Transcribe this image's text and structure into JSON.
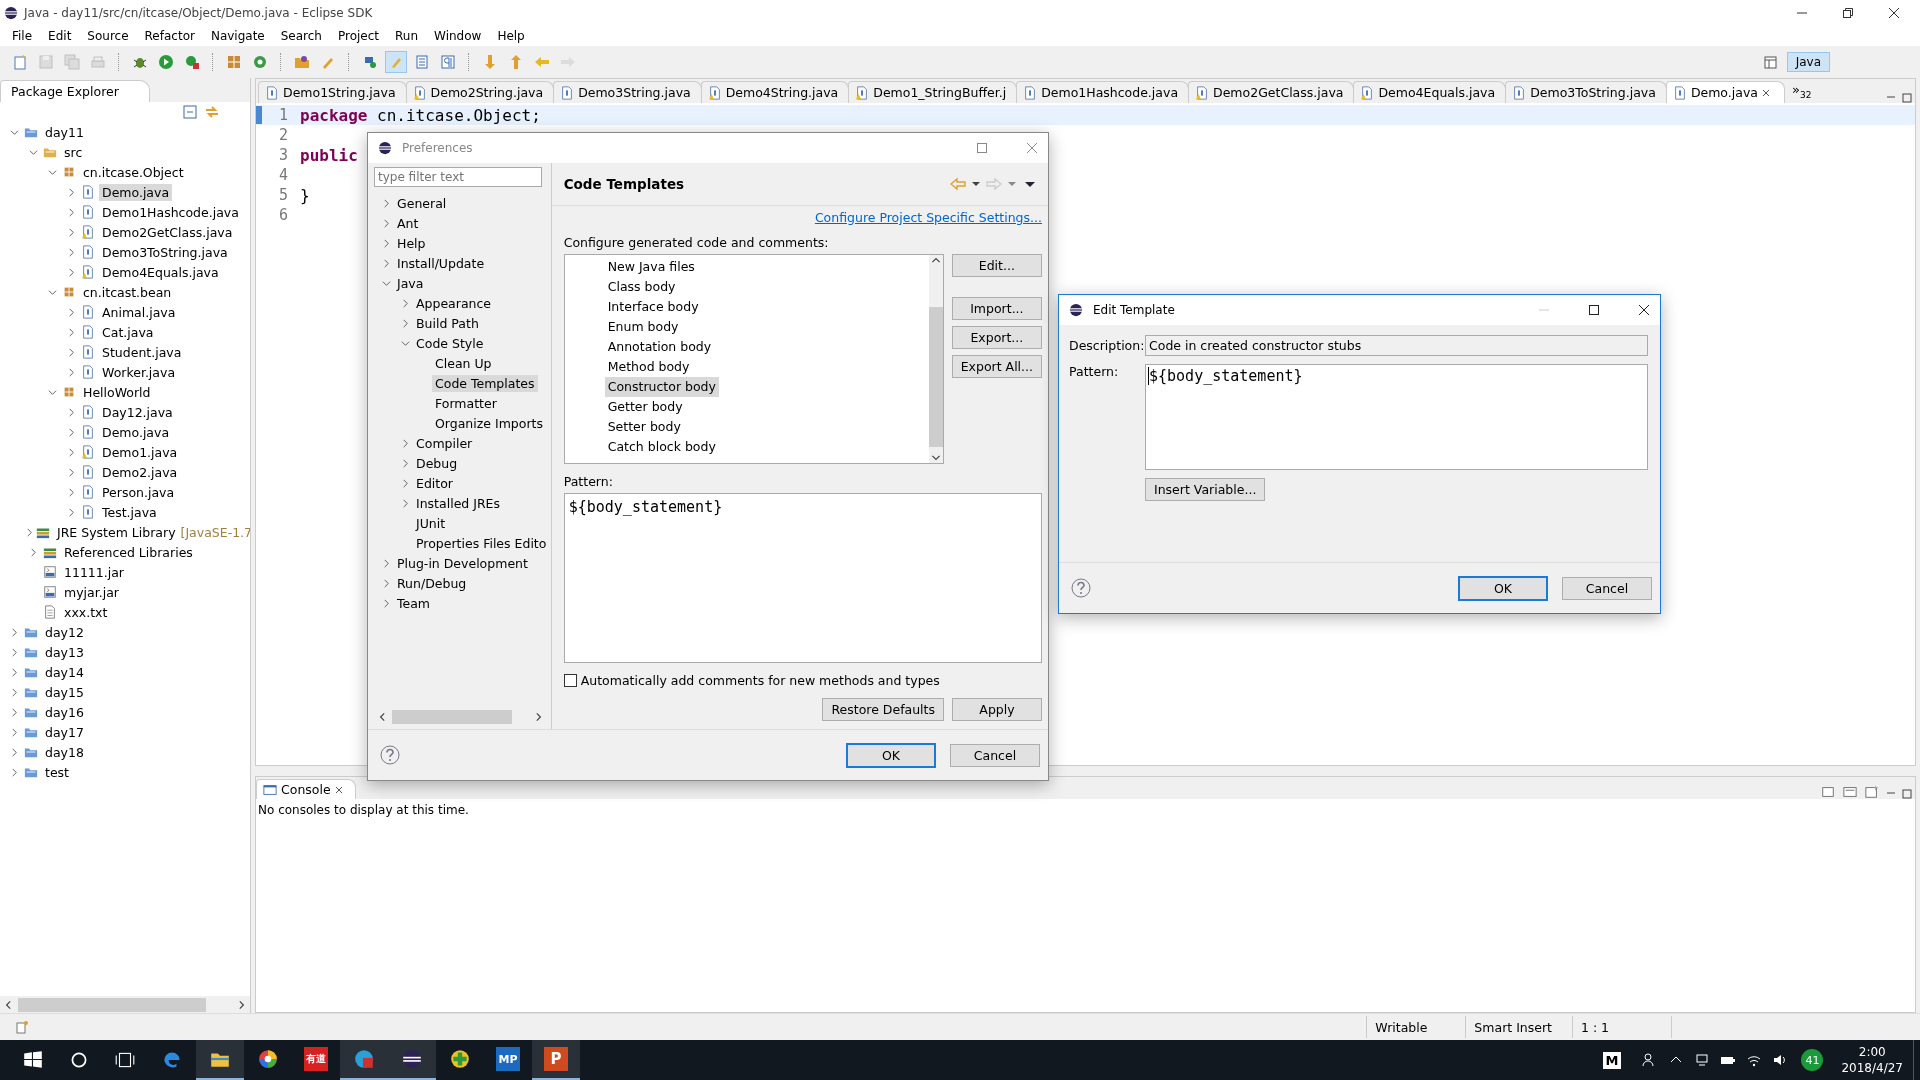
{
  "window": {
    "title": "Java - day11/src/cn/itcase/Object/Demo.java - Eclipse SDK"
  },
  "menu": [
    "File",
    "Edit",
    "Source",
    "Refactor",
    "Navigate",
    "Search",
    "Project",
    "Run",
    "Window",
    "Help"
  ],
  "perspective": {
    "label": "Java",
    "selected": true
  },
  "package_explorer": {
    "title": "Package Explorer",
    "items": [
      {
        "label": "day11",
        "kind": "project",
        "expanded": true,
        "selected": false,
        "children": [
          {
            "label": "src",
            "kind": "srcfolder",
            "expanded": true,
            "selected": false,
            "children": [
              {
                "label": "cn.itcase.Object",
                "kind": "package",
                "expanded": true,
                "selected": false,
                "children": [
                  {
                    "label": "Demo.java",
                    "kind": "java",
                    "expanded": false,
                    "selected": true
                  },
                  {
                    "label": "Demo1Hashcode.java",
                    "kind": "java",
                    "expanded": false,
                    "selected": false
                  },
                  {
                    "label": "Demo2GetClass.java",
                    "kind": "javawarn",
                    "expanded": false,
                    "selected": false
                  },
                  {
                    "label": "Demo3ToString.java",
                    "kind": "java",
                    "expanded": false,
                    "selected": false
                  },
                  {
                    "label": "Demo4Equals.java",
                    "kind": "javawarn",
                    "expanded": false,
                    "selected": false
                  }
                ]
              },
              {
                "label": "cn.itcast.bean",
                "kind": "package",
                "expanded": true,
                "selected": false,
                "children": [
                  {
                    "label": "Animal.java",
                    "kind": "java",
                    "expanded": false,
                    "selected": false
                  },
                  {
                    "label": "Cat.java",
                    "kind": "java",
                    "expanded": false,
                    "selected": false
                  },
                  {
                    "label": "Student.java",
                    "kind": "java",
                    "expanded": false,
                    "selected": false
                  },
                  {
                    "label": "Worker.java",
                    "kind": "java",
                    "expanded": false,
                    "selected": false
                  }
                ]
              },
              {
                "label": "HelloWorld",
                "kind": "package",
                "expanded": true,
                "selected": false,
                "children": [
                  {
                    "label": "Day12.java",
                    "kind": "java",
                    "expanded": false,
                    "selected": false
                  },
                  {
                    "label": "Demo.java",
                    "kind": "java",
                    "expanded": false,
                    "selected": false
                  },
                  {
                    "label": "Demo1.java",
                    "kind": "javawarn",
                    "expanded": false,
                    "selected": false
                  },
                  {
                    "label": "Demo2.java",
                    "kind": "java",
                    "expanded": false,
                    "selected": false
                  },
                  {
                    "label": "Person.java",
                    "kind": "java",
                    "expanded": false,
                    "selected": false
                  },
                  {
                    "label": "Test.java",
                    "kind": "java",
                    "expanded": false,
                    "selected": false
                  }
                ]
              }
            ]
          },
          {
            "label": "JRE System Library",
            "suffix": "[JavaSE-1.7",
            "kind": "library",
            "expanded": false,
            "selected": false
          },
          {
            "label": "Referenced Libraries",
            "kind": "library",
            "expanded": false,
            "selected": false
          },
          {
            "label": "11111.jar",
            "kind": "jar",
            "selected": false
          },
          {
            "label": "myjar.jar",
            "kind": "jar",
            "selected": false
          },
          {
            "label": "xxx.txt",
            "kind": "txt",
            "selected": false
          }
        ]
      },
      {
        "label": "day12",
        "kind": "project",
        "expanded": false,
        "selected": false
      },
      {
        "label": "day13",
        "kind": "project",
        "expanded": false,
        "selected": false
      },
      {
        "label": "day14",
        "kind": "project",
        "expanded": false,
        "selected": false
      },
      {
        "label": "day15",
        "kind": "project",
        "expanded": false,
        "selected": false
      },
      {
        "label": "day16",
        "kind": "project",
        "expanded": false,
        "selected": false
      },
      {
        "label": "day17",
        "kind": "project",
        "expanded": false,
        "selected": false
      },
      {
        "label": "day18",
        "kind": "project",
        "expanded": false,
        "selected": false
      },
      {
        "label": "test",
        "kind": "project",
        "expanded": false,
        "selected": false
      }
    ]
  },
  "editor_tabs": [
    {
      "label": "Demo1String.java",
      "warning": false,
      "selected": false
    },
    {
      "label": "Demo2String.java",
      "warning": true,
      "selected": false
    },
    {
      "label": "Demo3String.java",
      "warning": false,
      "selected": false
    },
    {
      "label": "Demo4String.java",
      "warning": true,
      "selected": false
    },
    {
      "label": "Demo1_StringBuffer.j",
      "warning": true,
      "selected": false
    },
    {
      "label": "Demo1Hashcode.java",
      "warning": false,
      "selected": false
    },
    {
      "label": "Demo2GetClass.java",
      "warning": true,
      "selected": false
    },
    {
      "label": "Demo4Equals.java",
      "warning": true,
      "selected": false
    },
    {
      "label": "Demo3ToString.java",
      "warning": false,
      "selected": false
    },
    {
      "label": "Demo.java",
      "warning": false,
      "selected": true
    }
  ],
  "tab_overflow": {
    "symbol": "»",
    "count": "32"
  },
  "editor_lines": [
    {
      "number": "1",
      "tokens": [
        {
          "text": "package",
          "kind": "keyword"
        },
        {
          "text": " cn.itcase.Object;",
          "kind": "plain"
        }
      ]
    },
    {
      "number": "2"
    },
    {
      "number": "3",
      "tokens": [
        {
          "text": "public",
          "kind": "keyword"
        }
      ]
    },
    {
      "number": "4"
    },
    {
      "number": "5",
      "tokens": [
        {
          "text": "}",
          "kind": "plain"
        }
      ]
    },
    {
      "number": "6"
    }
  ],
  "preferences": {
    "title": "Preferences",
    "filter_placeholder": "type filter text",
    "tree": [
      {
        "label": "General",
        "expanded": false,
        "selected": false
      },
      {
        "label": "Ant",
        "expanded": false,
        "selected": false
      },
      {
        "label": "Help",
        "expanded": false,
        "selected": false
      },
      {
        "label": "Install/Update",
        "expanded": false,
        "selected": false
      },
      {
        "label": "Java",
        "expanded": true,
        "selected": false,
        "children": [
          {
            "label": "Appearance",
            "expanded": false,
            "selected": false
          },
          {
            "label": "Build Path",
            "expanded": false,
            "selected": false
          },
          {
            "label": "Code Style",
            "expanded": true,
            "selected": false,
            "children": [
              {
                "label": "Clean Up",
                "selected": false
              },
              {
                "label": "Code Templates",
                "selected": true
              },
              {
                "label": "Formatter",
                "selected": false
              },
              {
                "label": "Organize Imports",
                "selected": false
              }
            ]
          },
          {
            "label": "Compiler",
            "expanded": false,
            "selected": false
          },
          {
            "label": "Debug",
            "expanded": false,
            "selected": false
          },
          {
            "label": "Editor",
            "expanded": false,
            "selected": false
          },
          {
            "label": "Installed JREs",
            "expanded": false,
            "selected": false
          },
          {
            "label": "JUnit",
            "selected": false
          },
          {
            "label": "Properties Files Edito",
            "selected": false
          }
        ]
      },
      {
        "label": "Plug-in Development",
        "expanded": false,
        "selected": false
      },
      {
        "label": "Run/Debug",
        "expanded": false,
        "selected": false
      },
      {
        "label": "Team",
        "expanded": false,
        "selected": false
      }
    ],
    "page_title": "Code Templates",
    "link": "Configure Project Specific Settings...",
    "list_label": "Configure generated code and comments:",
    "templates": [
      {
        "label": "New Java files",
        "selected": false
      },
      {
        "label": "Class body",
        "selected": false
      },
      {
        "label": "Interface body",
        "selected": false
      },
      {
        "label": "Enum body",
        "selected": false
      },
      {
        "label": "Annotation body",
        "selected": false
      },
      {
        "label": "Method body",
        "selected": false
      },
      {
        "label": "Constructor body",
        "selected": true
      },
      {
        "label": "Getter body",
        "selected": false
      },
      {
        "label": "Setter body",
        "selected": false
      },
      {
        "label": "Catch block body",
        "selected": false
      }
    ],
    "side_buttons": [
      "Edit...",
      "Import...",
      "Export...",
      "Export All..."
    ],
    "pattern_label": "Pattern:",
    "pattern": "${body_statement}",
    "auto_comments": {
      "label": "Automatically add comments for new methods and types",
      "checked": false
    },
    "page_buttons": [
      "Restore Defaults",
      "Apply"
    ],
    "ok": "OK",
    "cancel": "Cancel"
  },
  "edit_template": {
    "title": "Edit Template",
    "description_label": "Description:",
    "description": "Code in created constructor stubs",
    "pattern_label": "Pattern:",
    "pattern": "${body_statement}",
    "insert_button": "Insert Variable...",
    "ok": "OK",
    "cancel": "Cancel"
  },
  "console": {
    "title": "Console",
    "message": "No consoles to display at this time."
  },
  "status_bar": [
    "Writable",
    "Smart Insert",
    "1 : 1"
  ],
  "taskbar": {
    "apps": [
      {
        "kind": "edge",
        "running": false
      },
      {
        "kind": "folder",
        "running": true
      },
      {
        "kind": "wheel",
        "running": false
      },
      {
        "kind": "youdao",
        "label": "有道",
        "running": false
      },
      {
        "kind": "record",
        "running": true
      },
      {
        "kind": "eclipse",
        "running": true
      },
      {
        "kind": "plus",
        "running": false
      },
      {
        "kind": "mp",
        "label": "MP",
        "running": false
      },
      {
        "kind": "ppt",
        "label": "P",
        "running": true
      }
    ],
    "ime": "M",
    "battery_badge": "41",
    "time": "2:00",
    "date": "2018/4/27"
  }
}
